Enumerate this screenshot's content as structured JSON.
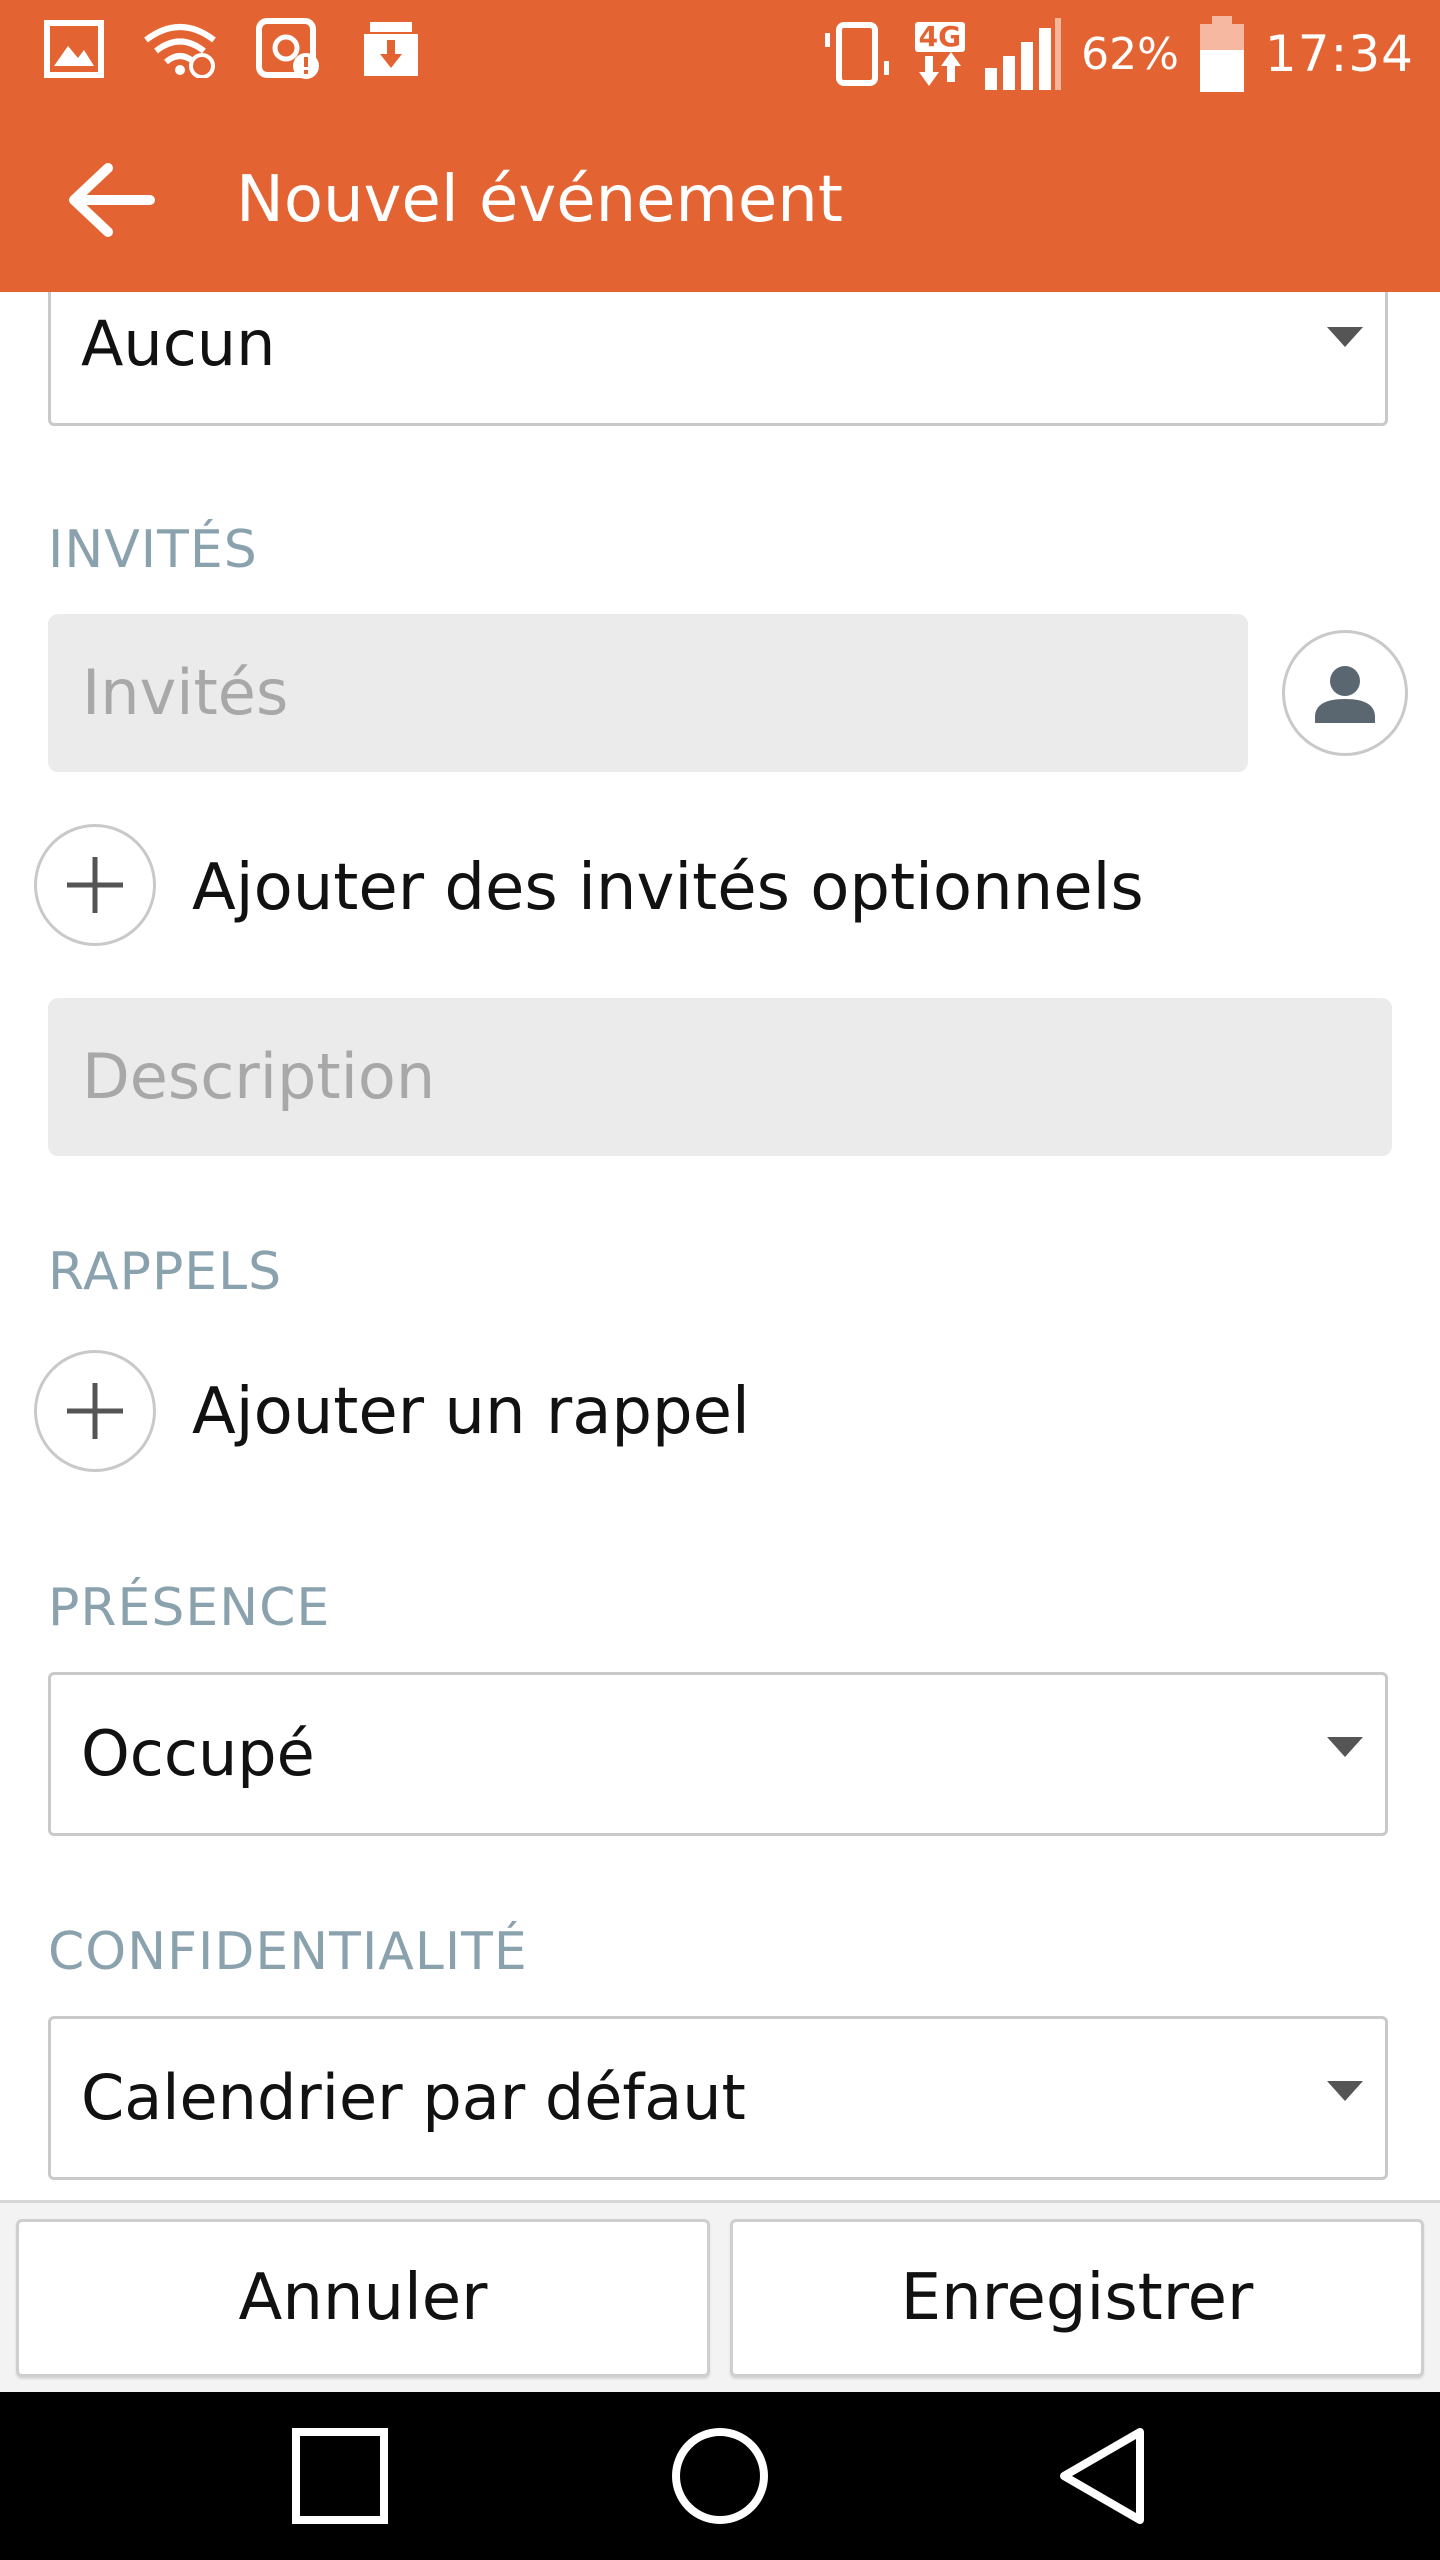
{
  "status_bar": {
    "network": "4G",
    "battery_percent": "62%",
    "time": "17:34"
  },
  "app_bar": {
    "title": "Nouvel événement",
    "back_icon": "arrow-back-icon"
  },
  "form": {
    "top_select_value": "Aucun",
    "guests": {
      "section_label": "INVITÉS",
      "placeholder": "Invités",
      "contacts_icon": "person-icon",
      "add_optional_label": "Ajouter des invités optionnels"
    },
    "description": {
      "placeholder": "Description"
    },
    "reminders": {
      "section_label": "RAPPELS",
      "add_label": "Ajouter un rappel"
    },
    "presence": {
      "section_label": "PRÉSENCE",
      "value": "Occupé"
    },
    "privacy": {
      "section_label": "CONFIDENTIALITÉ",
      "value": "Calendrier par défaut"
    }
  },
  "actions": {
    "cancel_label": "Annuler",
    "save_label": "Enregistrer"
  },
  "colors": {
    "accent": "#E36432",
    "section_label": "#8AA1AE"
  }
}
